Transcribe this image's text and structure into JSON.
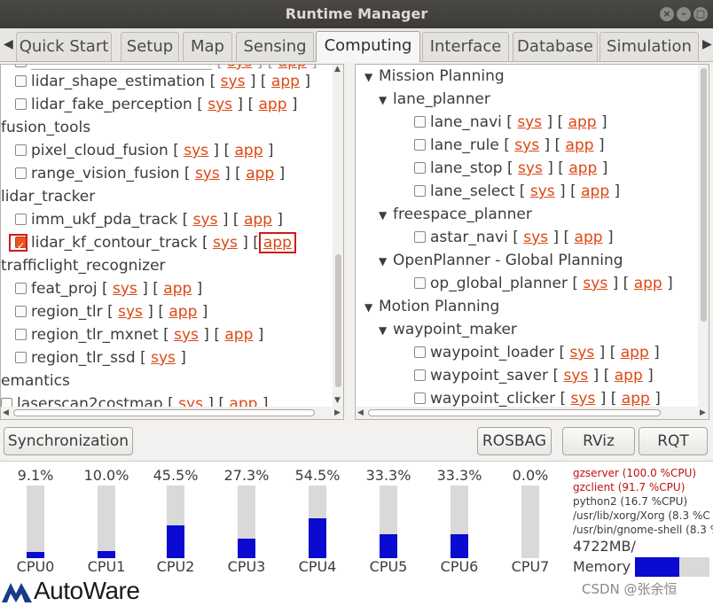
{
  "window": {
    "title": "Runtime Manager"
  },
  "tabs": [
    {
      "label": "Quick Start"
    },
    {
      "label": "Setup"
    },
    {
      "label": "Map"
    },
    {
      "label": "Sensing"
    },
    {
      "label": "Computing",
      "active": true
    },
    {
      "label": "Interface"
    },
    {
      "label": "Database"
    },
    {
      "label": "Simulation"
    }
  ],
  "left_tree": [
    {
      "label": "lidar_shape_estimation"
    },
    {
      "label": "lidar_fake_perception"
    },
    {
      "group": "fusion_tools"
    },
    {
      "label": "pixel_cloud_fusion"
    },
    {
      "label": "range_vision_fusion"
    },
    {
      "group": "lidar_tracker"
    },
    {
      "label": "imm_ukf_pda_track"
    },
    {
      "label": "lidar_kf_contour_track",
      "checked": true
    },
    {
      "group": "trafficlight_recognizer"
    },
    {
      "label": "feat_proj"
    },
    {
      "label": "region_tlr"
    },
    {
      "label": "region_tlr_mxnet"
    },
    {
      "label": "region_tlr_ssd",
      "no_app": true
    },
    {
      "group": "emantics"
    },
    {
      "label": "laserscan2costmap"
    }
  ],
  "right_tree": {
    "mission": "Mission Planning",
    "lane_planner": "lane_planner",
    "lane_items": [
      "lane_navi",
      "lane_rule",
      "lane_stop",
      "lane_select"
    ],
    "freespace": "freespace_planner",
    "astar": "astar_navi",
    "openplanner": "OpenPlanner - Global Planning",
    "op_global": "op_global_planner",
    "motion": "Motion Planning",
    "waypoint": "waypoint_maker",
    "wp_items": [
      "waypoint_loader",
      "waypoint_saver",
      "waypoint_clicker"
    ]
  },
  "link_sys": "sys",
  "link_app": "app",
  "buttons": {
    "sync": "Synchronization",
    "rosbag": "ROSBAG",
    "rviz": "RViz",
    "rqt": "RQT"
  },
  "cpus": [
    {
      "label": "CPU0",
      "pct": "9.1%",
      "value": 9.1
    },
    {
      "label": "CPU1",
      "pct": "10.0%",
      "value": 10.0
    },
    {
      "label": "CPU2",
      "pct": "45.5%",
      "value": 45.5
    },
    {
      "label": "CPU3",
      "pct": "27.3%",
      "value": 27.3
    },
    {
      "label": "CPU4",
      "pct": "54.5%",
      "value": 54.5
    },
    {
      "label": "CPU5",
      "pct": "33.3%",
      "value": 33.3
    },
    {
      "label": "CPU6",
      "pct": "33.3%",
      "value": 33.3
    },
    {
      "label": "CPU7",
      "pct": "0.0%",
      "value": 0.0
    }
  ],
  "processes": [
    {
      "text": "gzserver (100.0 %CPU)",
      "color": "#c01010"
    },
    {
      "text": "gzclient (91.7 %CPU)",
      "color": "#c01010"
    },
    {
      "text": "python2 (16.7 %CPU)",
      "color": "#3c3c3c"
    },
    {
      "text": "/usr/lib/xorg/Xorg (8.3 %C",
      "color": "#3c3c3c"
    },
    {
      "text": "/usr/bin/gnome-shell (8.3 %",
      "color": "#3c3c3c"
    }
  ],
  "memory": {
    "value": "4722MB/",
    "label": "Memory",
    "fraction": 0.6
  },
  "logo": {
    "text": "AutoWare"
  },
  "watermark": "CSDN @张余恒",
  "colors": {
    "accent": "#dd4814",
    "bar": "#0a0ad0",
    "highlight": "#d01b1b"
  }
}
